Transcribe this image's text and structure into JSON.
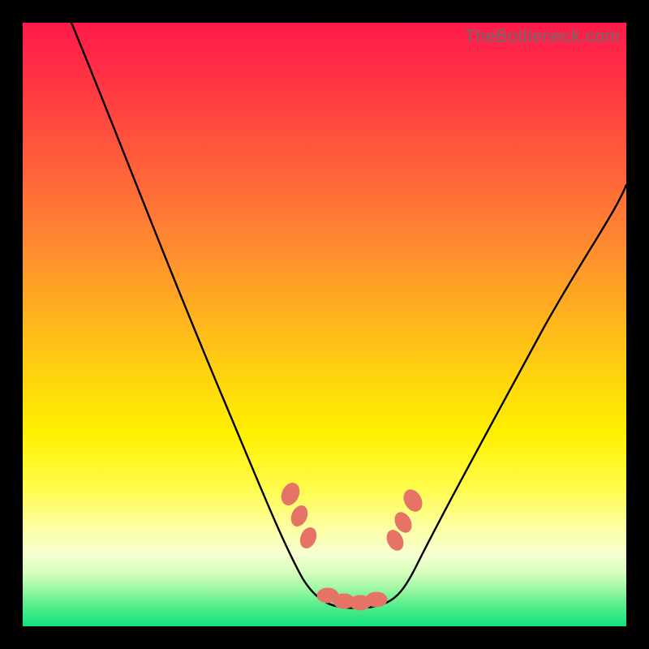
{
  "watermark": "TheBottleneck.com",
  "colors": {
    "frame": "#000000",
    "curve": "#000000",
    "beads": "#e57467",
    "gradient_top": "#ff1a4b",
    "gradient_bottom": "#14e27e"
  },
  "chart_data": {
    "type": "line",
    "title": "",
    "xlabel": "",
    "ylabel": "",
    "xlim": [
      0,
      100
    ],
    "ylim": [
      0,
      100
    ],
    "grid": false,
    "legend": false,
    "note": "Axes are unlabeled; values are normalized 0–100 from pixel positions (0 = left/bottom, 100 = right/top). Curve is a V-shaped bottleneck curve with minimum near x≈55, y≈4.",
    "series": [
      {
        "name": "bottleneck-curve",
        "x": [
          8,
          12,
          16,
          20,
          24,
          28,
          32,
          36,
          40,
          44,
          47,
          49,
          51,
          53,
          55,
          57,
          59,
          61,
          64,
          68,
          72,
          76,
          80,
          84,
          88,
          92,
          96,
          100
        ],
        "y": [
          100,
          92,
          84,
          75,
          66,
          58,
          49,
          41,
          32,
          24,
          17,
          12,
          8,
          5.5,
          4,
          4.2,
          5,
          7,
          11,
          18,
          26,
          34,
          42,
          50,
          57,
          63,
          69,
          73
        ]
      }
    ],
    "markers": [
      {
        "name": "bead-left-1",
        "x": 44.5,
        "y": 22
      },
      {
        "name": "bead-left-2",
        "x": 46.0,
        "y": 18
      },
      {
        "name": "bead-left-3",
        "x": 47.5,
        "y": 14.5
      },
      {
        "name": "bead-flat-1",
        "x": 50.5,
        "y": 5.2
      },
      {
        "name": "bead-flat-2",
        "x": 53.0,
        "y": 4.3
      },
      {
        "name": "bead-flat-3",
        "x": 55.5,
        "y": 4.0
      },
      {
        "name": "bead-flat-4",
        "x": 58.0,
        "y": 4.6
      },
      {
        "name": "bead-right-1",
        "x": 61.5,
        "y": 14
      },
      {
        "name": "bead-right-2",
        "x": 62.8,
        "y": 17
      },
      {
        "name": "bead-right-3",
        "x": 64.5,
        "y": 21
      }
    ]
  }
}
